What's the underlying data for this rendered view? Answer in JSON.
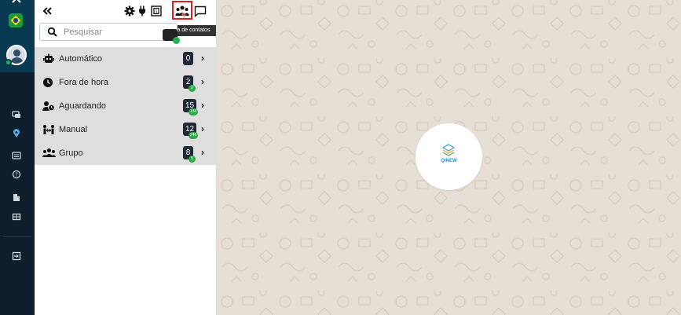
{
  "header": {
    "tooltip": "Lista de contatos"
  },
  "search": {
    "placeholder": "Pesquisar"
  },
  "rows": [
    {
      "label": "Automático",
      "count": "0",
      "sub": ""
    },
    {
      "label": "Fora de hora",
      "count": "2",
      "sub": "2"
    },
    {
      "label": "Aguardando",
      "count": "15",
      "sub": "134"
    },
    {
      "label": "Manual",
      "count": "12",
      "sub": "246"
    },
    {
      "label": "Grupo",
      "count": "8",
      "sub": "5"
    }
  ],
  "logo": {
    "text": "QINEW"
  },
  "colors": {
    "rail": "#0f1e2c",
    "rail_top": "#0a3a52",
    "list_bg": "#dedede",
    "badge": "#1f2a36",
    "badge_sub": "#2daa48",
    "highlight": "#e02020",
    "chat_bg": "#e6dfd6"
  },
  "icons": {
    "rail": [
      "chevron-up-icon",
      "brazil-flag-icon",
      "user-avatar-icon",
      "chat-icon",
      "location-icon",
      "list-icon",
      "help-icon",
      "building-icon",
      "grid-icon",
      "logout-icon"
    ],
    "header": [
      "collapse-icon",
      "gear-icon",
      "plug-icon",
      "window-icon",
      "contacts-icon",
      "message-icon"
    ]
  }
}
